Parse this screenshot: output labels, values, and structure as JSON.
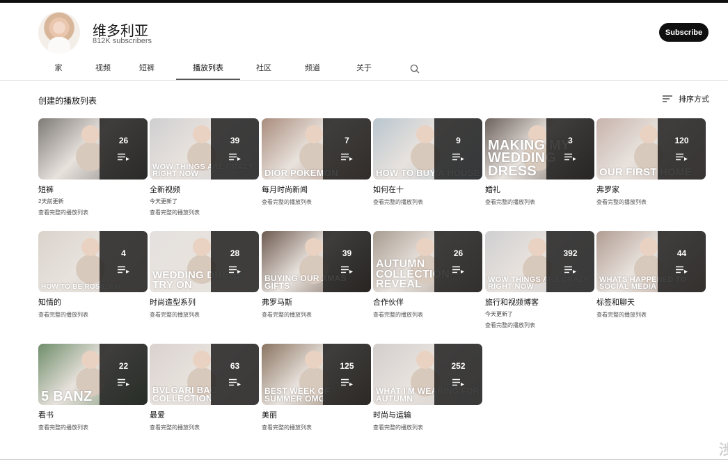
{
  "channel": {
    "name": "维多利亚",
    "subscribers": "812K subscribers",
    "subscribe_label": "Subscribe"
  },
  "tabs": [
    {
      "label": "家"
    },
    {
      "label": "视频"
    },
    {
      "label": "短裤"
    },
    {
      "label": "播放列表",
      "active": true
    },
    {
      "label": "社区"
    },
    {
      "label": "频道"
    },
    {
      "label": "关于"
    }
  ],
  "section": {
    "title": "创建的播放列表",
    "sort_label": "排序方式"
  },
  "playlist_link_label": "查看完整的播放列表",
  "playlists": [
    {
      "title": "短裤",
      "count": "26",
      "updated": "2天前更新",
      "thumb_text": "",
      "bg": "#7d7a76"
    },
    {
      "title": "全新视频",
      "count": "39",
      "updated": "今天更新了",
      "thumb_text": "WOW THINGS ARE CRAZY RIGHT NOW",
      "bg": "#cfcfd1"
    },
    {
      "title": "每月时尚新闻",
      "count": "7",
      "updated": "",
      "thumb_text": "DIOR POKEMON",
      "bg": "#a98c7c"
    },
    {
      "title": "如何在十",
      "count": "9",
      "updated": "",
      "thumb_text": "HOW TO BUY A HOUSE",
      "bg": "#b9c6cf"
    },
    {
      "title": "婚礼",
      "count": "3",
      "updated": "",
      "thumb_text": "MAKING MY WEDDING DRESS",
      "bg": "#6d625d"
    },
    {
      "title": "弗罗家",
      "count": "120",
      "updated": "",
      "thumb_text": "OUR FIRST HOME",
      "bg": "#c7b3ac"
    },
    {
      "title": "知情的",
      "count": "4",
      "updated": "",
      "thumb_text": "HOW TO BE ROSIE HW",
      "bg": "#dad3cc"
    },
    {
      "title": "时尚造型系列",
      "count": "28",
      "updated": "",
      "thumb_text": "WEDDING DRESS TRY ON",
      "bg": "#e4e1de"
    },
    {
      "title": "弗罗马斯",
      "count": "39",
      "updated": "",
      "thumb_text": "BUYING OUR XMAS GIFTS",
      "bg": "#6d5a4f"
    },
    {
      "title": "合作伙伴",
      "count": "26",
      "updated": "",
      "thumb_text": "AUTUMN COLLECTION REVEAL",
      "bg": "#a89c90"
    },
    {
      "title": "旅行和视频博客",
      "count": "392",
      "updated": "今天更新了",
      "thumb_text": "WOW THINGS ARE CRAZY RIGHT NOW",
      "bg": "#cfcfd1"
    },
    {
      "title": "标签和聊天",
      "count": "44",
      "updated": "",
      "thumb_text": "WHATS HAPPENED TO SOCIAL MEDIA",
      "bg": "#b19d92"
    },
    {
      "title": "看书",
      "count": "22",
      "updated": "",
      "thumb_text": "5 BANZ",
      "bg": "#6f8d6a"
    },
    {
      "title": "最爱",
      "count": "63",
      "updated": "",
      "thumb_text": "BVLGARI BAG COLLECTION",
      "bg": "#d9d2cf"
    },
    {
      "title": "美丽",
      "count": "125",
      "updated": "",
      "thumb_text": "BEST WEEK OF SUMMER OMG",
      "bg": "#8a7460"
    },
    {
      "title": "时尚与运输",
      "count": "252",
      "updated": "",
      "thumb_text": "WHAT I'M WEARING FOR AUTUMN",
      "bg": "#d2cecc"
    }
  ]
}
